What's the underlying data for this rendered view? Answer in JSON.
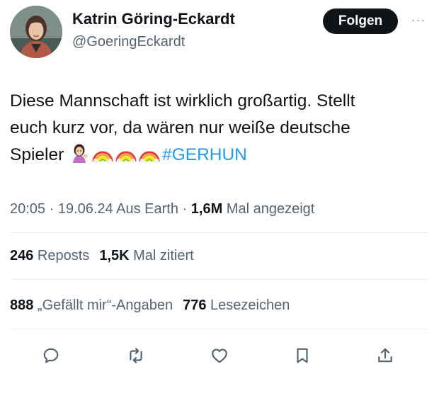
{
  "author": {
    "name": "Katrin Göring-Eckardt",
    "handle": "@GoeringEckardt",
    "avatar_icon": "profile-photo"
  },
  "header": {
    "follow_label": "Folgen",
    "more_label": "···"
  },
  "tweet": {
    "text_line1": "Diese Mannschaft ist wirklich großartig. Stellt",
    "text_line2": "euch kurz vor, da wären nur weiße deutsche",
    "text_line3": "Spieler",
    "emojis": [
      "person-tipping-hand",
      "rainbow",
      "rainbow",
      "rainbow"
    ],
    "hashtag": "#GERHUN"
  },
  "meta": {
    "time": "20:05",
    "separator1": " · ",
    "date": "19.06.24",
    "source": " Aus Earth",
    "separator2": " · ",
    "views_count": "1,6M",
    "views_label": " Mal angezeigt"
  },
  "stats": {
    "reposts_count": "246",
    "reposts_label": " Reposts",
    "quotes_count": "1,5K",
    "quotes_label": " Mal zitiert",
    "likes_count": "888",
    "likes_label": " „Gefällt mir“-Angaben",
    "bookmarks_count": "776",
    "bookmarks_label": " Lesezeichen"
  },
  "actions": [
    "reply-icon",
    "repost-icon",
    "like-icon",
    "bookmark-icon",
    "share-icon"
  ],
  "colors": {
    "text": "#0f1419",
    "secondary": "#536471",
    "link": "#1d9bf0",
    "button_bg": "#0f1419",
    "button_text": "#ffffff",
    "divider": "#e6ecf0"
  }
}
